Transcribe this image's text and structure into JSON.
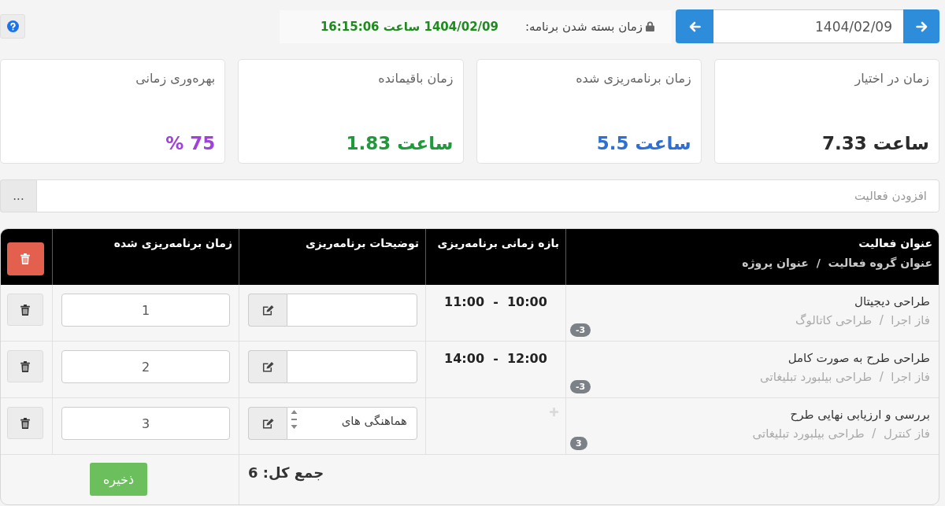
{
  "date_navigator": {
    "value": "1404/02/09"
  },
  "closing_time": {
    "label": "زمان بسته شدن برنامه:",
    "value": "1404/02/09 ساعت 16:15:06"
  },
  "cards": [
    {
      "label": "زمان در اختیار",
      "value": "ساعت 7.33",
      "color": "#2b2b2b"
    },
    {
      "label": "زمان برنامه‌ریزی شده",
      "value": "ساعت 5.5",
      "color": "#2f6fd3"
    },
    {
      "label": "زمان باقیمانده",
      "value": "ساعت 1.83",
      "color": "#1e9a3b"
    },
    {
      "label": "بهره‌وری زمانی",
      "value": "75 %",
      "color": "#a040dd"
    }
  ],
  "add_activity": {
    "placeholder": "افزودن فعالیت",
    "button": "..."
  },
  "table": {
    "columns": [
      {
        "title": "عنوان فعالیت",
        "subtitle": "عنوان گروه فعالیت  /  عنوان پروژه"
      },
      {
        "title": "بازه زمانی برنامه‌ریزی"
      },
      {
        "title": "توضیحات برنامه‌ریزی"
      },
      {
        "title": "زمان برنامه‌ریزی شده"
      }
    ],
    "rows": [
      {
        "title": "طراحی دیجیتال",
        "subtitle": "فاز اجرا  /  طراحی کاتالوگ",
        "badge": "-3",
        "time_range": "10:00  -  11:00",
        "planned_time": "1"
      },
      {
        "title": "طراحی طرح به صورت کامل",
        "subtitle": "فاز اجرا  /  طراحی بیلبورد تبلیغاتی",
        "badge": "-3",
        "time_range": "12:00  -  14:00",
        "planned_time": "2"
      },
      {
        "title": "بررسی و ارزیابی نهایی طرح",
        "subtitle": "فاز کنترل  /  طراحی بیلبورد تبلیغاتی",
        "badge": "3",
        "description": "هماهنگی های",
        "planned_time": "3"
      }
    ],
    "total": "جمع کل: 6",
    "save_button": "ذخیره"
  }
}
